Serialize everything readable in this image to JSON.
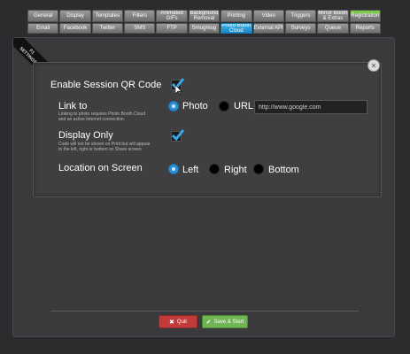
{
  "tabs": {
    "row1": [
      "General",
      "Display",
      "Templates",
      "Filters",
      "Animated\nGIFs",
      "Background\nRemoval",
      "Printing",
      "Video",
      "Triggers",
      "Mirror Booth\n& Extras",
      "Registration"
    ],
    "row1_top_badge": "Update",
    "row2": [
      "Email",
      "Facebook",
      "Twitter",
      "SMS",
      "FTP",
      "Smugmug",
      "Photo Booth\nCloud",
      "External API",
      "Surveys",
      "Queue",
      "Reports"
    ],
    "active": "Photo Booth\nCloud"
  },
  "ribbon": {
    "line1": "F1",
    "line2": "SETTINGS"
  },
  "settings": {
    "enable_qr_label": "Enable Session QR Code",
    "link_to_label": "Link to",
    "link_to_note": "Linking to photo requires Photo Booth Cloud\nand an active Internet connection.",
    "link_photo": "Photo",
    "link_url": "URL",
    "url_value": "http://www.google.com",
    "display_only_label": "Display Only",
    "display_only_note": "Code will not be shown on Print but will appear\nto the left, right or bottom on Share screen",
    "location_label": "Location on Screen",
    "loc_left": "Left",
    "loc_right": "Right",
    "loc_bottom": "Bottom"
  },
  "buttons": {
    "quit": "Quit",
    "save": "Save & Start"
  },
  "colors": {
    "accent": "#2a8fd6",
    "quit": "#c23a3a",
    "save": "#6fb552"
  }
}
